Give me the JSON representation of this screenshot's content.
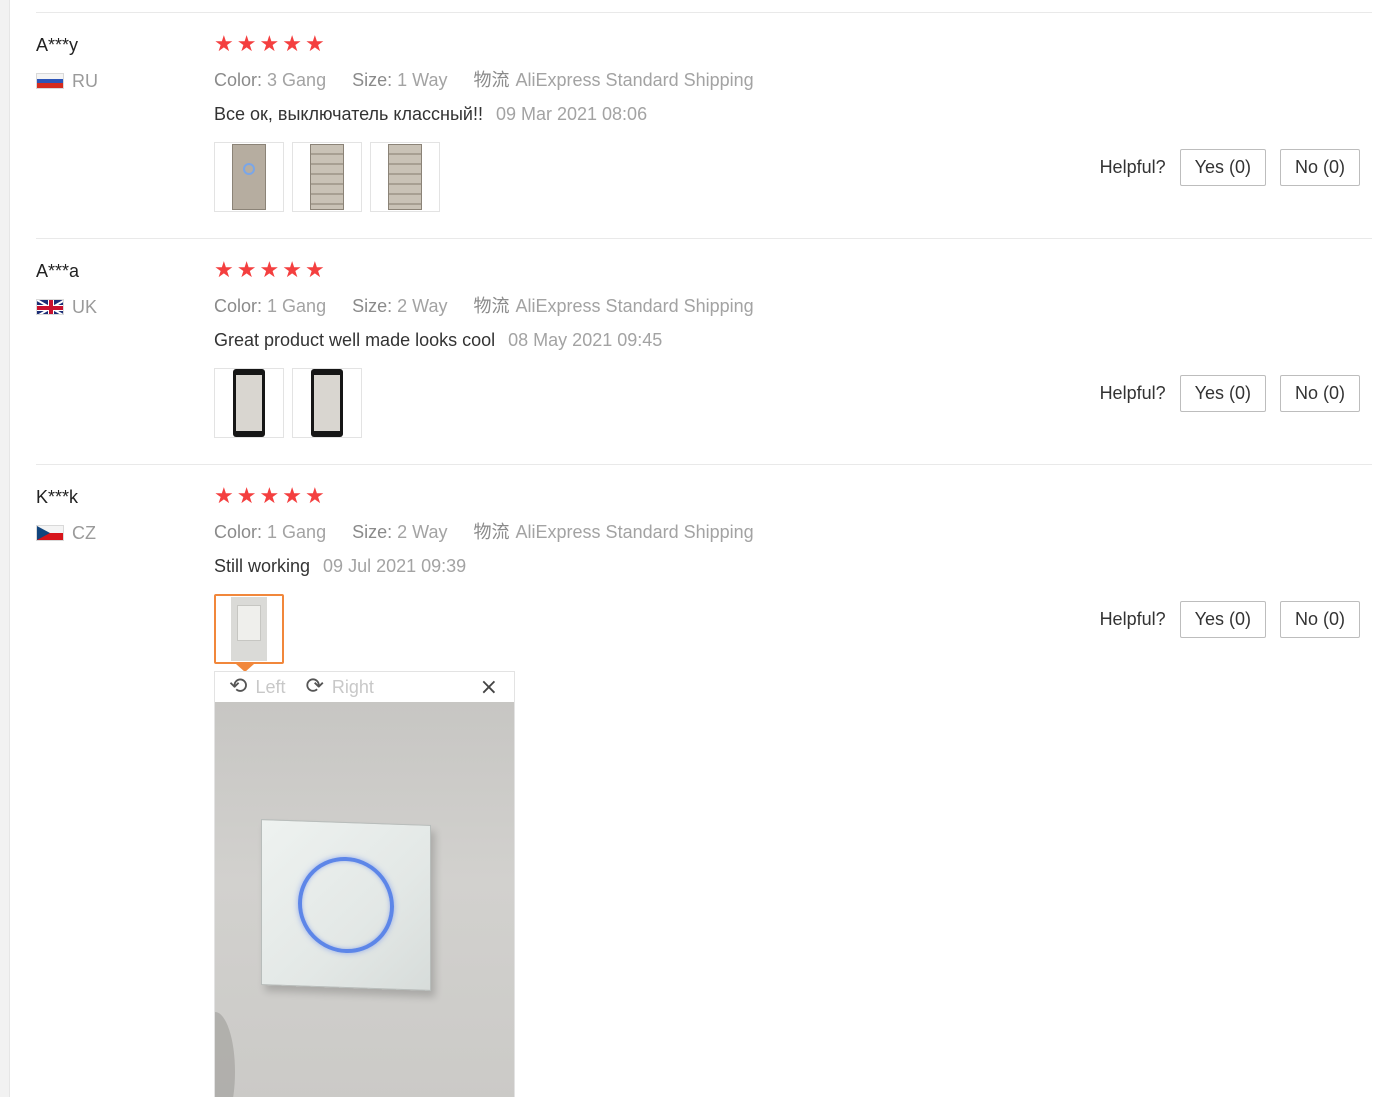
{
  "helpful_label": "Helpful?",
  "reviews": [
    {
      "user": "A***y",
      "country": "RU",
      "rating": 5,
      "color_label": "Color:",
      "color_value": "3 Gang",
      "size_label": "Size:",
      "size_value": "1 Way",
      "shipping_icon": "物流",
      "shipping": "AliExpress Standard Shipping",
      "text": "Все ок, выключатель классный!!",
      "date": "09 Mar 2021 08:06",
      "yes": "Yes (0)",
      "no": "No (0)"
    },
    {
      "user": "A***a",
      "country": "UK",
      "rating": 5,
      "color_label": "Color:",
      "color_value": "1 Gang",
      "size_label": "Size:",
      "size_value": "2 Way",
      "shipping_icon": "物流",
      "shipping": "AliExpress Standard Shipping",
      "text": "Great product well made looks cool",
      "date": "08 May 2021 09:45",
      "yes": "Yes (0)",
      "no": "No (0)"
    },
    {
      "user": "K***k",
      "country": "CZ",
      "rating": 5,
      "color_label": "Color:",
      "color_value": "1 Gang",
      "size_label": "Size:",
      "size_value": "2 Way",
      "shipping_icon": "物流",
      "shipping": "AliExpress Standard Shipping",
      "text": "Still working",
      "date": "09 Jul 2021 09:39",
      "yes": "Yes (0)",
      "no": "No (0)"
    }
  ],
  "viewer": {
    "rotate_left": "Left",
    "rotate_right": "Right",
    "close": "×"
  },
  "colors": {
    "star": "#f43f3f",
    "active_thumb_border": "#f1873b",
    "muted_text": "#a3a3a3"
  }
}
